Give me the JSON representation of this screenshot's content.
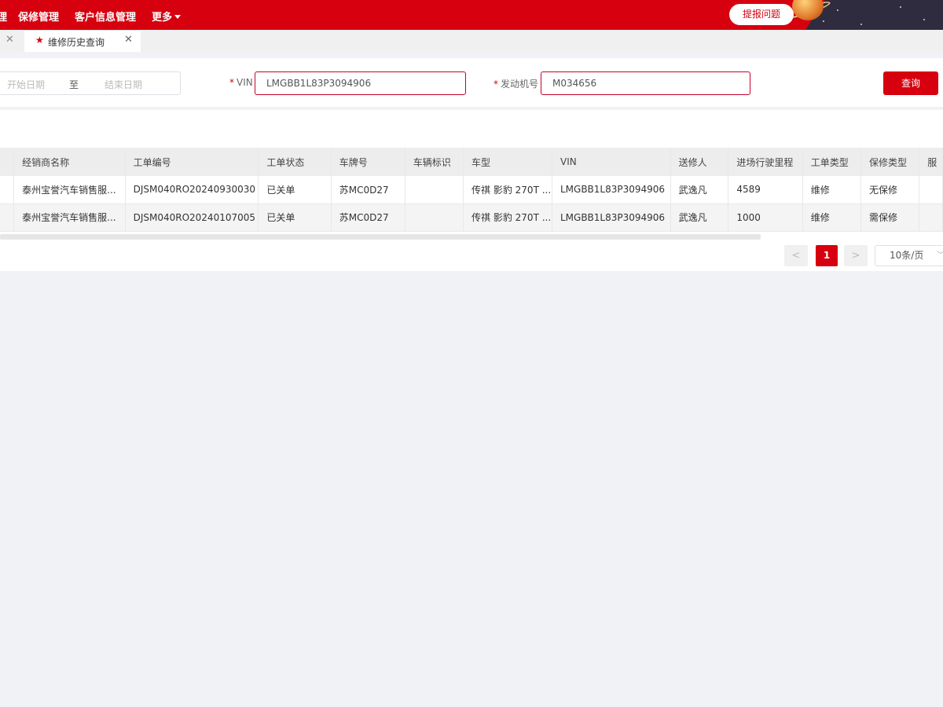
{
  "nav": {
    "items": [
      {
        "label": "理"
      },
      {
        "label": "保修管理"
      },
      {
        "label": "客户信息管理"
      },
      {
        "label": "更多"
      }
    ],
    "report_button": "提报问题"
  },
  "tabs": {
    "active_tab": "维修历史查询"
  },
  "search": {
    "start_date_placeholder": "开始日期",
    "date_separator": "至",
    "end_date_placeholder": "结束日期",
    "vin_label": "VIN",
    "vin_value": "LMGBB1L83P3094906",
    "engine_label": "发动机号",
    "engine_value": "M034656",
    "query_button": "查询"
  },
  "table": {
    "columns": [
      "经销商名称",
      "工单编号",
      "工单状态",
      "车牌号",
      "车辆标识",
      "车型",
      "VIN",
      "送修人",
      "进场行驶里程",
      "工单类型",
      "保修类型",
      "服"
    ],
    "rows": [
      [
        "泰州宝誉汽车销售服...",
        "DJSM040RO20240930030",
        "已关单",
        "苏MC0D27",
        "",
        "传祺 影豹 270T ...",
        "LMGBB1L83P3094906",
        "武逸凡",
        "4589",
        "维修",
        "无保修",
        ""
      ],
      [
        "泰州宝誉汽车销售服...",
        "DJSM040RO20240107005",
        "已关单",
        "苏MC0D27",
        "",
        "传祺 影豹 270T ...",
        "LMGBB1L83P3094906",
        "武逸凡",
        "1000",
        "维修",
        "需保修",
        ""
      ]
    ]
  },
  "pagination": {
    "prev": "<",
    "current_page": "1",
    "next": ">",
    "page_size": "10条/页"
  },
  "colors": {
    "brand_red": "#d6000f",
    "page_bg": "#f0f2f5"
  }
}
